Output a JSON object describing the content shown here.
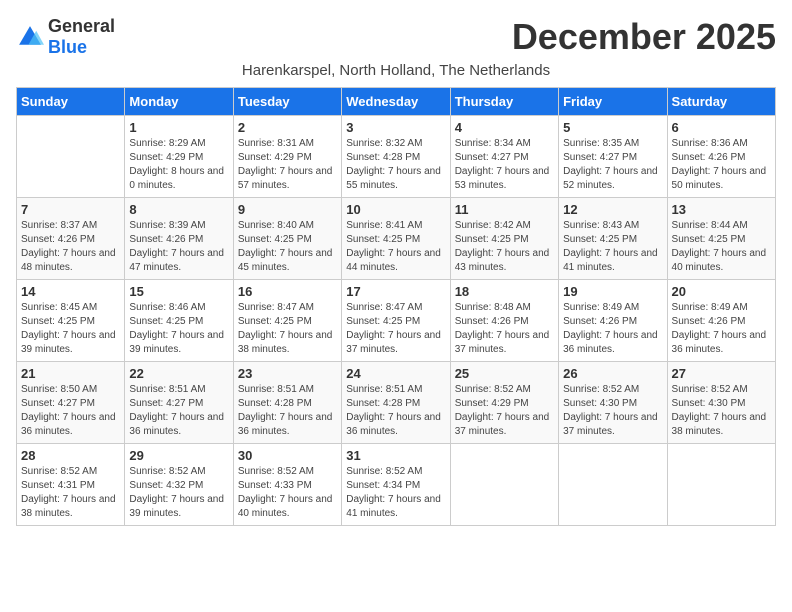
{
  "logo": {
    "general": "General",
    "blue": "Blue"
  },
  "title": "December 2025",
  "location": "Harenkarspel, North Holland, The Netherlands",
  "days_header": [
    "Sunday",
    "Monday",
    "Tuesday",
    "Wednesday",
    "Thursday",
    "Friday",
    "Saturday"
  ],
  "weeks": [
    [
      {
        "day": "",
        "sunrise": "",
        "sunset": "",
        "daylight": ""
      },
      {
        "day": "1",
        "sunrise": "Sunrise: 8:29 AM",
        "sunset": "Sunset: 4:29 PM",
        "daylight": "Daylight: 8 hours and 0 minutes."
      },
      {
        "day": "2",
        "sunrise": "Sunrise: 8:31 AM",
        "sunset": "Sunset: 4:29 PM",
        "daylight": "Daylight: 7 hours and 57 minutes."
      },
      {
        "day": "3",
        "sunrise": "Sunrise: 8:32 AM",
        "sunset": "Sunset: 4:28 PM",
        "daylight": "Daylight: 7 hours and 55 minutes."
      },
      {
        "day": "4",
        "sunrise": "Sunrise: 8:34 AM",
        "sunset": "Sunset: 4:27 PM",
        "daylight": "Daylight: 7 hours and 53 minutes."
      },
      {
        "day": "5",
        "sunrise": "Sunrise: 8:35 AM",
        "sunset": "Sunset: 4:27 PM",
        "daylight": "Daylight: 7 hours and 52 minutes."
      },
      {
        "day": "6",
        "sunrise": "Sunrise: 8:36 AM",
        "sunset": "Sunset: 4:26 PM",
        "daylight": "Daylight: 7 hours and 50 minutes."
      }
    ],
    [
      {
        "day": "7",
        "sunrise": "Sunrise: 8:37 AM",
        "sunset": "Sunset: 4:26 PM",
        "daylight": "Daylight: 7 hours and 48 minutes."
      },
      {
        "day": "8",
        "sunrise": "Sunrise: 8:39 AM",
        "sunset": "Sunset: 4:26 PM",
        "daylight": "Daylight: 7 hours and 47 minutes."
      },
      {
        "day": "9",
        "sunrise": "Sunrise: 8:40 AM",
        "sunset": "Sunset: 4:25 PM",
        "daylight": "Daylight: 7 hours and 45 minutes."
      },
      {
        "day": "10",
        "sunrise": "Sunrise: 8:41 AM",
        "sunset": "Sunset: 4:25 PM",
        "daylight": "Daylight: 7 hours and 44 minutes."
      },
      {
        "day": "11",
        "sunrise": "Sunrise: 8:42 AM",
        "sunset": "Sunset: 4:25 PM",
        "daylight": "Daylight: 7 hours and 43 minutes."
      },
      {
        "day": "12",
        "sunrise": "Sunrise: 8:43 AM",
        "sunset": "Sunset: 4:25 PM",
        "daylight": "Daylight: 7 hours and 41 minutes."
      },
      {
        "day": "13",
        "sunrise": "Sunrise: 8:44 AM",
        "sunset": "Sunset: 4:25 PM",
        "daylight": "Daylight: 7 hours and 40 minutes."
      }
    ],
    [
      {
        "day": "14",
        "sunrise": "Sunrise: 8:45 AM",
        "sunset": "Sunset: 4:25 PM",
        "daylight": "Daylight: 7 hours and 39 minutes."
      },
      {
        "day": "15",
        "sunrise": "Sunrise: 8:46 AM",
        "sunset": "Sunset: 4:25 PM",
        "daylight": "Daylight: 7 hours and 39 minutes."
      },
      {
        "day": "16",
        "sunrise": "Sunrise: 8:47 AM",
        "sunset": "Sunset: 4:25 PM",
        "daylight": "Daylight: 7 hours and 38 minutes."
      },
      {
        "day": "17",
        "sunrise": "Sunrise: 8:47 AM",
        "sunset": "Sunset: 4:25 PM",
        "daylight": "Daylight: 7 hours and 37 minutes."
      },
      {
        "day": "18",
        "sunrise": "Sunrise: 8:48 AM",
        "sunset": "Sunset: 4:26 PM",
        "daylight": "Daylight: 7 hours and 37 minutes."
      },
      {
        "day": "19",
        "sunrise": "Sunrise: 8:49 AM",
        "sunset": "Sunset: 4:26 PM",
        "daylight": "Daylight: 7 hours and 36 minutes."
      },
      {
        "day": "20",
        "sunrise": "Sunrise: 8:49 AM",
        "sunset": "Sunset: 4:26 PM",
        "daylight": "Daylight: 7 hours and 36 minutes."
      }
    ],
    [
      {
        "day": "21",
        "sunrise": "Sunrise: 8:50 AM",
        "sunset": "Sunset: 4:27 PM",
        "daylight": "Daylight: 7 hours and 36 minutes."
      },
      {
        "day": "22",
        "sunrise": "Sunrise: 8:51 AM",
        "sunset": "Sunset: 4:27 PM",
        "daylight": "Daylight: 7 hours and 36 minutes."
      },
      {
        "day": "23",
        "sunrise": "Sunrise: 8:51 AM",
        "sunset": "Sunset: 4:28 PM",
        "daylight": "Daylight: 7 hours and 36 minutes."
      },
      {
        "day": "24",
        "sunrise": "Sunrise: 8:51 AM",
        "sunset": "Sunset: 4:28 PM",
        "daylight": "Daylight: 7 hours and 36 minutes."
      },
      {
        "day": "25",
        "sunrise": "Sunrise: 8:52 AM",
        "sunset": "Sunset: 4:29 PM",
        "daylight": "Daylight: 7 hours and 37 minutes."
      },
      {
        "day": "26",
        "sunrise": "Sunrise: 8:52 AM",
        "sunset": "Sunset: 4:30 PM",
        "daylight": "Daylight: 7 hours and 37 minutes."
      },
      {
        "day": "27",
        "sunrise": "Sunrise: 8:52 AM",
        "sunset": "Sunset: 4:30 PM",
        "daylight": "Daylight: 7 hours and 38 minutes."
      }
    ],
    [
      {
        "day": "28",
        "sunrise": "Sunrise: 8:52 AM",
        "sunset": "Sunset: 4:31 PM",
        "daylight": "Daylight: 7 hours and 38 minutes."
      },
      {
        "day": "29",
        "sunrise": "Sunrise: 8:52 AM",
        "sunset": "Sunset: 4:32 PM",
        "daylight": "Daylight: 7 hours and 39 minutes."
      },
      {
        "day": "30",
        "sunrise": "Sunrise: 8:52 AM",
        "sunset": "Sunset: 4:33 PM",
        "daylight": "Daylight: 7 hours and 40 minutes."
      },
      {
        "day": "31",
        "sunrise": "Sunrise: 8:52 AM",
        "sunset": "Sunset: 4:34 PM",
        "daylight": "Daylight: 7 hours and 41 minutes."
      },
      {
        "day": "",
        "sunrise": "",
        "sunset": "",
        "daylight": ""
      },
      {
        "day": "",
        "sunrise": "",
        "sunset": "",
        "daylight": ""
      },
      {
        "day": "",
        "sunrise": "",
        "sunset": "",
        "daylight": ""
      }
    ]
  ]
}
